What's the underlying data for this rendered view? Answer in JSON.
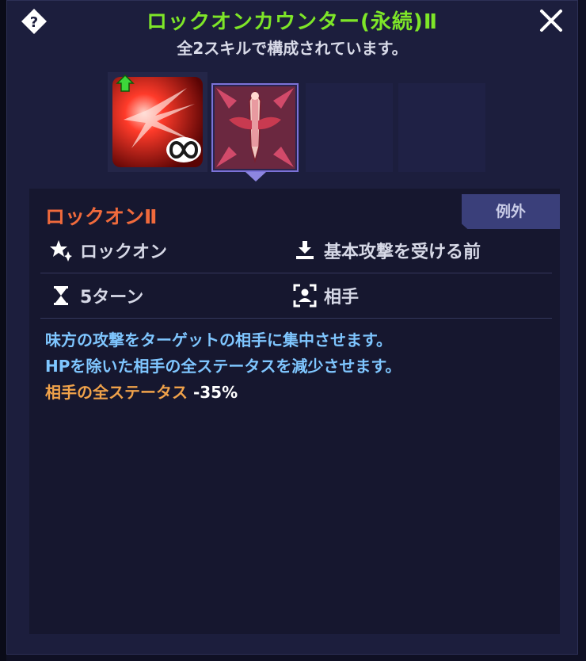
{
  "header": {
    "title": "ロックオンカウンター(永続)Ⅱ",
    "subtitle": "全2スキルで構成されています。"
  },
  "icons": {
    "help": "help-diamond-icon",
    "close": "close-icon"
  },
  "skill": {
    "tag": "例外",
    "name": "ロックオンⅡ",
    "type": "ロックオン",
    "timing": "基本攻撃を受ける前",
    "duration": "5ターン",
    "target": "相手",
    "desc_line1": "味方の攻撃をターゲットの相手に集中させます。",
    "desc_line2": "HPを除いた相手の全ステータスを減少させます。",
    "stat_label": "相手の全ステータス",
    "stat_value": "-35%"
  },
  "colors": {
    "title": "#7ee628",
    "skill_name": "#f06a3c",
    "desc": "#7fc6ff",
    "stat_label": "#f0a24a"
  }
}
